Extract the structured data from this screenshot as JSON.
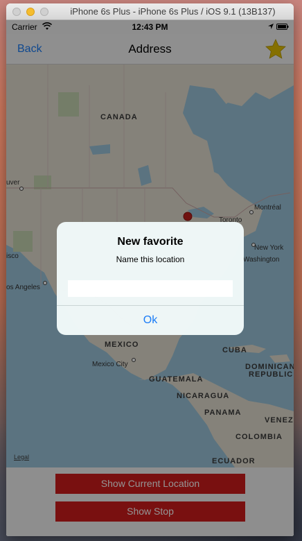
{
  "window": {
    "title": "iPhone 6s Plus - iPhone 6s Plus / iOS 9.1 (13B137)"
  },
  "status_bar": {
    "carrier": "Carrier",
    "time": "12:43 PM"
  },
  "nav": {
    "back_label": "Back",
    "title": "Address",
    "favorite_icon": "star-icon",
    "star_color": "#e6c200"
  },
  "map": {
    "labels": {
      "canada": "CANADA",
      "vancouver": "uver",
      "montreal": "Montréal",
      "toronto": "Toronto",
      "new_york": "New York",
      "washington": "Washington",
      "francisco": "isco",
      "los_angeles": "os Angeles",
      "mexico": "MEXICO",
      "mexico_city": "Mexico City",
      "cuba": "CUBA",
      "dominican_republic_line1": "DOMINICAN",
      "dominican_republic_line2": "REPUBLIC",
      "guatemala": "GUATEMALA",
      "nicaragua": "NICARAGUA",
      "panama": "PANAMA",
      "venezuela": "VENEZ",
      "colombia": "COLOMBIA",
      "ecuador": "ECUADOR"
    },
    "legal": "Legal",
    "pin_color": "#c0201c"
  },
  "buttons": {
    "show_current_location": "Show Current Location",
    "show_stop": "Show Stop",
    "button_color": "#d01d1d"
  },
  "alert": {
    "title": "New favorite",
    "message": "Name this location",
    "input_value": "",
    "ok_label": "Ok"
  }
}
